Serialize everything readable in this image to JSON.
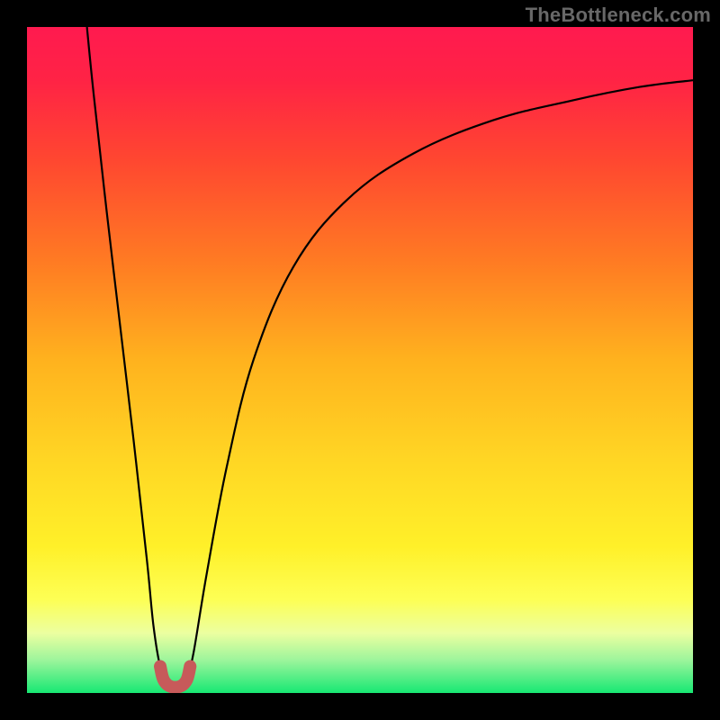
{
  "watermark": "TheBottleneck.com",
  "gradient": {
    "stops": [
      {
        "offset": "0%",
        "color": "#ff1a4f"
      },
      {
        "offset": "8%",
        "color": "#ff2345"
      },
      {
        "offset": "20%",
        "color": "#ff4730"
      },
      {
        "offset": "35%",
        "color": "#ff7a23"
      },
      {
        "offset": "50%",
        "color": "#ffb21e"
      },
      {
        "offset": "65%",
        "color": "#ffd624"
      },
      {
        "offset": "78%",
        "color": "#fff029"
      },
      {
        "offset": "86%",
        "color": "#fdff55"
      },
      {
        "offset": "91%",
        "color": "#ecffa0"
      },
      {
        "offset": "95%",
        "color": "#9ef59c"
      },
      {
        "offset": "100%",
        "color": "#17e873"
      }
    ]
  },
  "curve_style": {
    "stroke": "#000000",
    "stroke_width": 2.2
  },
  "marker_style": {
    "stroke": "#c75a5a",
    "stroke_width": 14,
    "linecap": "round"
  },
  "chart_data": {
    "type": "line",
    "title": "",
    "xlabel": "",
    "ylabel": "",
    "xlim": [
      0,
      100
    ],
    "ylim": [
      0,
      100
    ],
    "grid": false,
    "note": "Axes are unlabeled in the source image; values are normalized 0–100 estimates read from pixel positions. Lower y means closer to the green zone (better).",
    "series": [
      {
        "name": "left-branch",
        "x": [
          9,
          10,
          12,
          14,
          16,
          18,
          19,
          20,
          21
        ],
        "y": [
          100,
          90,
          72,
          55,
          38,
          20,
          10,
          4,
          2
        ]
      },
      {
        "name": "right-branch",
        "x": [
          24,
          25,
          27,
          30,
          34,
          40,
          48,
          58,
          70,
          82,
          92,
          100
        ],
        "y": [
          2,
          6,
          18,
          34,
          50,
          64,
          74,
          81,
          86,
          89,
          91,
          92
        ]
      },
      {
        "name": "bottom-u-marker",
        "x": [
          20,
          20.5,
          21.5,
          23,
          24,
          24.5
        ],
        "y": [
          4,
          2,
          1,
          1,
          2,
          4
        ]
      }
    ]
  }
}
